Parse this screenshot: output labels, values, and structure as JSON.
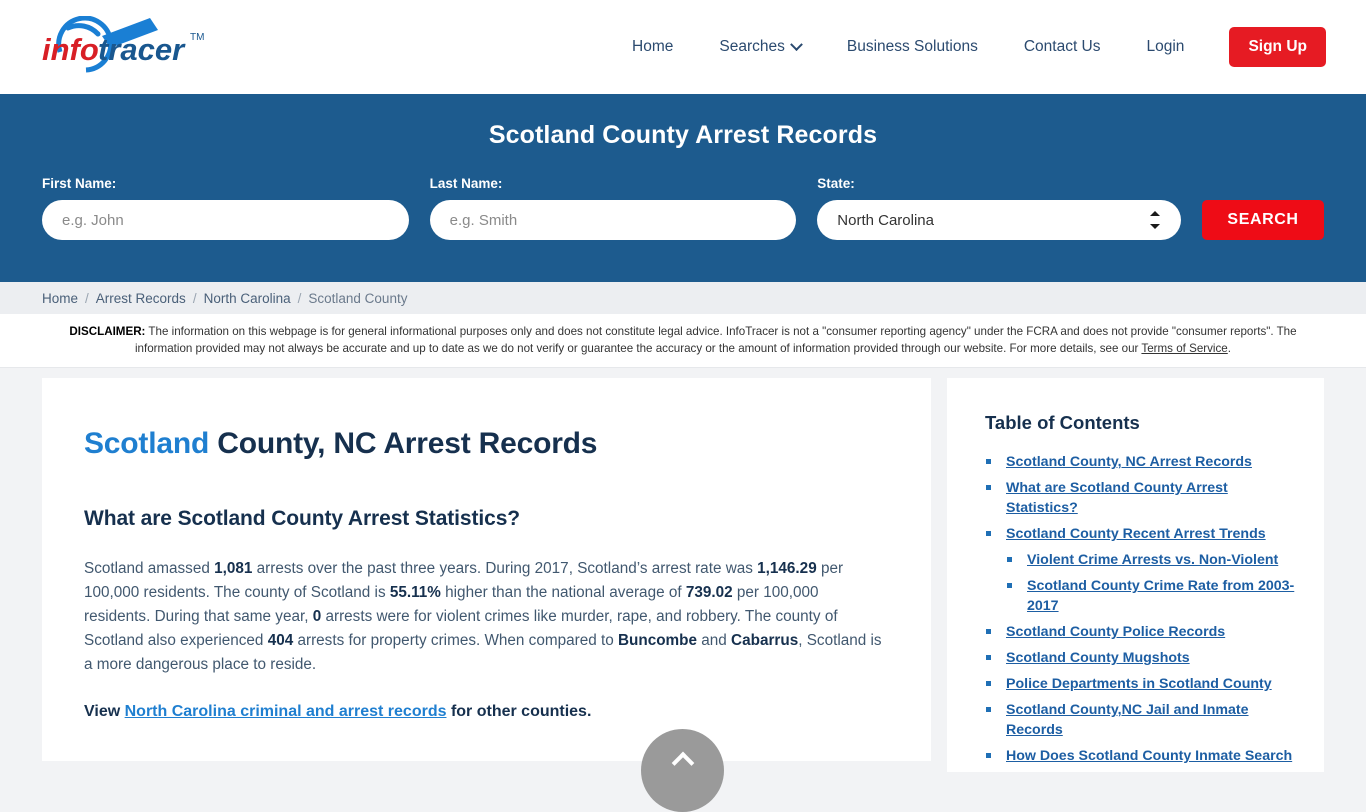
{
  "header": {
    "logo_alt": "infotracer",
    "logo_text_info": "info",
    "logo_text_tracer": "tracer",
    "logo_tm": "TM",
    "nav": [
      {
        "label": "Home",
        "has_caret": false
      },
      {
        "label": "Searches",
        "has_caret": true
      },
      {
        "label": "Business Solutions",
        "has_caret": false
      },
      {
        "label": "Contact Us",
        "has_caret": false
      },
      {
        "label": "Login",
        "has_caret": false
      }
    ],
    "signup_label": "Sign Up"
  },
  "banner": {
    "title": "Scotland County Arrest Records",
    "first_name_label": "First Name:",
    "first_name_placeholder": "e.g. John",
    "first_name_value": "",
    "last_name_label": "Last Name:",
    "last_name_placeholder": "e.g. Smith",
    "last_name_value": "",
    "state_label": "State:",
    "state_value": "North Carolina",
    "state_options": [
      "North Carolina"
    ],
    "search_label": "SEARCH",
    "accent_blue": "#1d5b8e",
    "accent_red": "#ee0c16"
  },
  "breadcrumb": [
    {
      "label": "Home",
      "current": false
    },
    {
      "label": "Arrest Records",
      "current": false
    },
    {
      "label": "North Carolina",
      "current": false
    },
    {
      "label": "Scotland County",
      "current": true
    }
  ],
  "breadcrumb_separator": "/",
  "disclaimer": {
    "label": "DISCLAIMER:",
    "text_before_link": " The information on this webpage is for general informational purposes only and does not constitute legal advice. InfoTracer is not a \"consumer reporting agency\" under the FCRA and does not provide \"consumer reports\". The information provided may not always be accurate and up to date as we do not verify or guarantee the accuracy or the amount of information provided through our website. For more details, see our ",
    "link_label": "Terms of Service",
    "text_after_link": "."
  },
  "main": {
    "h1_accent": "Scotland",
    "h1_rest": " County, NC Arrest Records",
    "h2": "What are Scotland County Arrest Statistics?",
    "paragraph": {
      "p1": "Scotland amassed ",
      "b1": "1,081",
      "p2": " arrests over the past three years. During 2017, Scotland’s arrest rate was ",
      "b2": "1,146.29",
      "p3": " per 100,000 residents. The county of Scotland is ",
      "b3": "55.11%",
      "p4": " higher than the national average of ",
      "b4": "739.02",
      "p5": " per 100,000 residents. During that same year, ",
      "b5": "0",
      "p6": " arrests were for violent crimes like murder, rape, and robbery. The county of Scotland also experienced ",
      "b6": "404",
      "p7": " arrests for property crimes. When compared to ",
      "b7": "Buncombe",
      "p8": " and ",
      "b8": "Cabarrus",
      "p9": ", Scotland is a more dangerous place to reside."
    },
    "view_prefix": "View ",
    "view_link": "North Carolina criminal and arrest records",
    "view_suffix": " for other counties."
  },
  "toc": {
    "title": "Table of Contents",
    "items": [
      {
        "label": "Scotland County, NC Arrest Records",
        "sub": false
      },
      {
        "label": "What are Scotland County Arrest Statistics?",
        "sub": false
      },
      {
        "label": "Scotland County Recent Arrest Trends",
        "sub": false
      },
      {
        "label": "Violent Crime Arrests vs. Non-Violent",
        "sub": true
      },
      {
        "label": "Scotland County Crime Rate from 2003-2017",
        "sub": true
      },
      {
        "label": "Scotland County Police Records",
        "sub": false
      },
      {
        "label": "Scotland County Mugshots",
        "sub": false
      },
      {
        "label": "Police Departments in Scotland County",
        "sub": false
      },
      {
        "label": "Scotland County,NC Jail and Inmate Records",
        "sub": false
      },
      {
        "label": "How Does Scotland County Inmate Search",
        "sub": false
      }
    ]
  },
  "scroll_top": {
    "label": ""
  }
}
